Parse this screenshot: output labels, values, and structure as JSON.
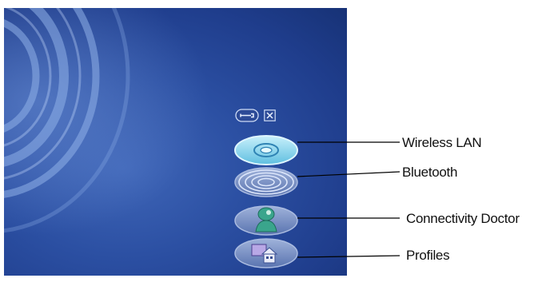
{
  "toolbar": {
    "settings_icon": "wrench-icon",
    "close_icon": "close-icon"
  },
  "buttons": [
    {
      "id": "wireless-lan",
      "icon": "wireless-lan-disc-icon",
      "label": "Wireless LAN"
    },
    {
      "id": "bluetooth",
      "icon": "bluetooth-rings-icon",
      "label": "Bluetooth"
    },
    {
      "id": "connectivity-doctor",
      "icon": "doctor-icon",
      "label": "Connectivity Doctor"
    },
    {
      "id": "profiles",
      "icon": "profiles-house-icon",
      "label": "Profiles"
    }
  ],
  "colors": {
    "background_dark": "#173276",
    "background_light": "#3f66b8",
    "wireless_active": "#8fd7ee",
    "button_inactive": "#7f95c4",
    "doctor_green": "#3aa58c",
    "callout_line": "#000000"
  }
}
